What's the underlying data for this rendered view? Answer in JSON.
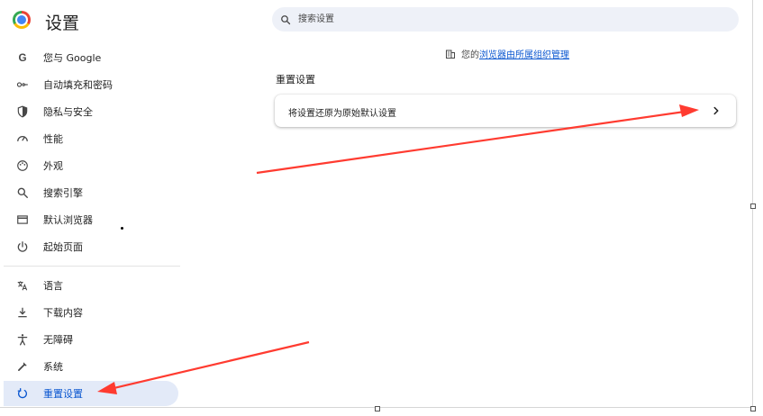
{
  "header": {
    "title": "设置",
    "search_placeholder": "搜索设置"
  },
  "sidebar": {
    "items": [
      {
        "label": "您与 Google",
        "icon": "google-icon"
      },
      {
        "label": "自动填充和密码",
        "icon": "key-icon"
      },
      {
        "label": "隐私与安全",
        "icon": "shield-icon"
      },
      {
        "label": "性能",
        "icon": "speedometer-icon"
      },
      {
        "label": "外观",
        "icon": "palette-icon"
      },
      {
        "label": "搜索引擎",
        "icon": "search-icon"
      },
      {
        "label": "默认浏览器",
        "icon": "browser-window-icon"
      },
      {
        "label": "起始页面",
        "icon": "power-icon"
      },
      {
        "label": "语言",
        "icon": "translate-icon"
      },
      {
        "label": "下载内容",
        "icon": "download-icon"
      },
      {
        "label": "无障碍",
        "icon": "accessibility-icon"
      },
      {
        "label": "系统",
        "icon": "wrench-icon"
      },
      {
        "label": "重置设置",
        "icon": "reset-icon",
        "active": true
      }
    ]
  },
  "main": {
    "managed_prefix": "您的",
    "managed_link": "浏览器由所属组织管理",
    "section_title": "重置设置",
    "reset_row_label": "将设置还原为原始默认设置"
  },
  "colors": {
    "accent": "#0b57d0",
    "active_bg": "#e3eaf8",
    "search_bg": "#eef1f8",
    "annotation_arrow": "#ff3b30"
  }
}
